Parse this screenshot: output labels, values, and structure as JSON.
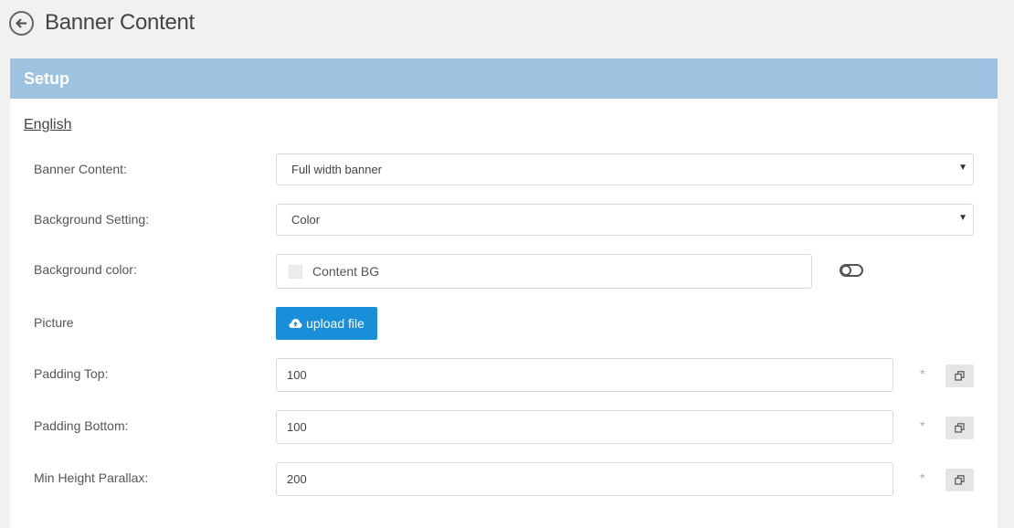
{
  "header": {
    "title": "Banner Content",
    "back_icon": "back-arrow-circle-icon"
  },
  "panel": {
    "heading": "Setup",
    "language_link": "English"
  },
  "form": {
    "banner_content": {
      "label": "Banner Content:",
      "value": "Full width banner"
    },
    "background_setting": {
      "label": "Background Setting:",
      "value": "Color"
    },
    "background_color": {
      "label": "Background color:",
      "value": "Content BG",
      "swatch_color": "#ececec"
    },
    "picture": {
      "label": "Picture",
      "button_label": "upload file"
    },
    "padding_top": {
      "label": "Padding Top:",
      "value": "100",
      "required_mark": "*"
    },
    "padding_bottom": {
      "label": "Padding Bottom:",
      "value": "100",
      "required_mark": "*"
    },
    "min_height_parallax": {
      "label": "Min Height Parallax:",
      "value": "200",
      "required_mark": "*"
    }
  },
  "colors": {
    "header_bar": "#9dc3e1",
    "upload_button": "#1a8fd9",
    "page_bg": "#f1f1f1"
  }
}
